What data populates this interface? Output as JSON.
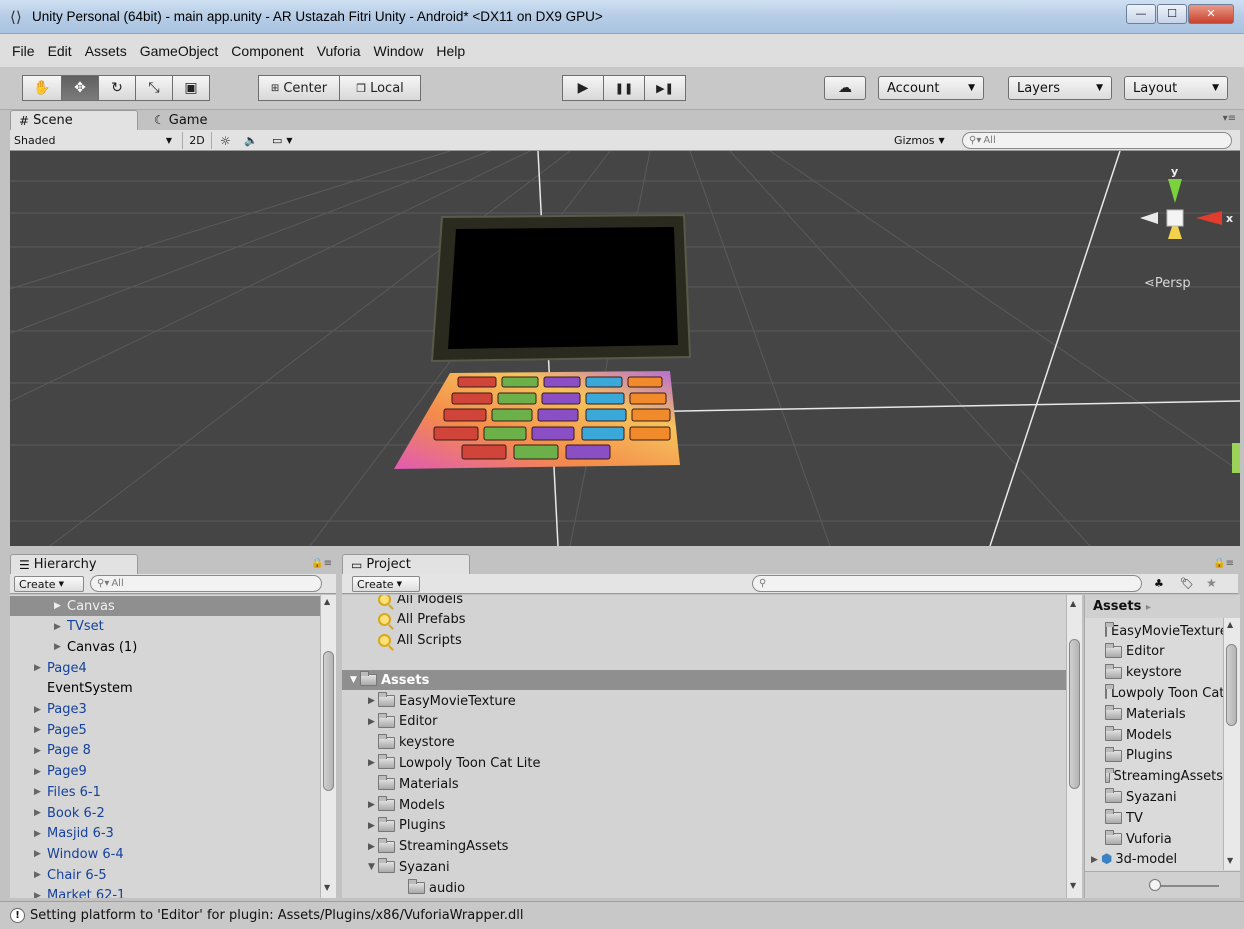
{
  "window": {
    "title": "Unity Personal (64bit) - main app.unity - AR Ustazah Fitri Unity - Android* <DX11 on DX9 GPU>",
    "minimize": "—",
    "maximize": "☐",
    "close": "✕"
  },
  "menu": [
    "File",
    "Edit",
    "Assets",
    "GameObject",
    "Component",
    "Vuforia",
    "Window",
    "Help"
  ],
  "toolbar": {
    "transform_tools": [
      "hand-icon",
      "move-icon",
      "rotate-icon",
      "scale-icon",
      "rect-tool-icon"
    ],
    "pivot_center": "Center",
    "pivot_local": "Local",
    "play_controls": [
      "▶",
      "❚❚",
      "▶❚"
    ],
    "account": "Account",
    "layers": "Layers",
    "layout": "Layout"
  },
  "scene": {
    "tabs": [
      {
        "label": "Scene",
        "icon": "#"
      },
      {
        "label": "Game",
        "icon": "☾"
      }
    ],
    "shading": "Shaded",
    "mode_2d": "2D",
    "gizmos": "Gizmos",
    "search_placeholder": "All",
    "persp_label": "Persp",
    "axis_y": "y",
    "axis_x": "x"
  },
  "hierarchy": {
    "tab": "Hierarchy",
    "create": "Create",
    "search_placeholder": "All",
    "items": [
      {
        "label": "Canvas",
        "indent": 2,
        "arrow": true,
        "blue": false,
        "selected": true
      },
      {
        "label": "TVset",
        "indent": 2,
        "arrow": true,
        "blue": true,
        "selected": false
      },
      {
        "label": "Canvas (1)",
        "indent": 2,
        "arrow": true,
        "blue": false,
        "selected": false
      },
      {
        "label": "Page4",
        "indent": 1,
        "arrow": true,
        "blue": true,
        "selected": false
      },
      {
        "label": "EventSystem",
        "indent": 1,
        "arrow": false,
        "blue": false,
        "selected": false
      },
      {
        "label": "Page3",
        "indent": 1,
        "arrow": true,
        "blue": true,
        "selected": false
      },
      {
        "label": "Page5",
        "indent": 1,
        "arrow": true,
        "blue": true,
        "selected": false
      },
      {
        "label": "Page 8",
        "indent": 1,
        "arrow": true,
        "blue": true,
        "selected": false
      },
      {
        "label": "Page9",
        "indent": 1,
        "arrow": true,
        "blue": true,
        "selected": false
      },
      {
        "label": "Files 6-1",
        "indent": 1,
        "arrow": true,
        "blue": true,
        "selected": false
      },
      {
        "label": "Book 6-2",
        "indent": 1,
        "arrow": true,
        "blue": true,
        "selected": false
      },
      {
        "label": "Masjid 6-3",
        "indent": 1,
        "arrow": true,
        "blue": true,
        "selected": false
      },
      {
        "label": "Window 6-4",
        "indent": 1,
        "arrow": true,
        "blue": true,
        "selected": false
      },
      {
        "label": "Chair 6-5",
        "indent": 1,
        "arrow": true,
        "blue": true,
        "selected": false
      },
      {
        "label": "Market 62-1",
        "indent": 1,
        "arrow": true,
        "blue": true,
        "selected": false
      }
    ]
  },
  "project": {
    "tab": "Project",
    "create": "Create",
    "favorites": [
      "All Models",
      "All Prefabs",
      "All Scripts"
    ],
    "root": "Assets",
    "tree": [
      {
        "label": "EasyMovieTexture",
        "indent": 1,
        "arrow": "▶"
      },
      {
        "label": "Editor",
        "indent": 1,
        "arrow": "▶"
      },
      {
        "label": "keystore",
        "indent": 1,
        "arrow": ""
      },
      {
        "label": "Lowpoly Toon Cat Lite",
        "indent": 1,
        "arrow": "▶"
      },
      {
        "label": "Materials",
        "indent": 1,
        "arrow": ""
      },
      {
        "label": "Models",
        "indent": 1,
        "arrow": "▶"
      },
      {
        "label": "Plugins",
        "indent": 1,
        "arrow": "▶"
      },
      {
        "label": "StreamingAssets",
        "indent": 1,
        "arrow": "▶"
      },
      {
        "label": "Syazani",
        "indent": 1,
        "arrow": "▼"
      },
      {
        "label": "audio",
        "indent": 2,
        "arrow": ""
      }
    ],
    "breadcrumb": "Assets",
    "breadcrumb_arrow": "▸",
    "assets": [
      "EasyMovieTexture",
      "Editor",
      "keystore",
      "Lowpoly Toon Cat Lite",
      "Materials",
      "Models",
      "Plugins",
      "StreamingAssets",
      "Syazani",
      "TV",
      "Vuforia",
      "3d-model"
    ]
  },
  "status": {
    "message": "Setting platform to 'Editor' for plugin: Assets/Plugins/x86/VuforiaWrapper.dll"
  },
  "colors": {
    "accent_selected": "#8f8f8f",
    "prefab_blue": "#15419c",
    "scene_bg": "#454545"
  }
}
